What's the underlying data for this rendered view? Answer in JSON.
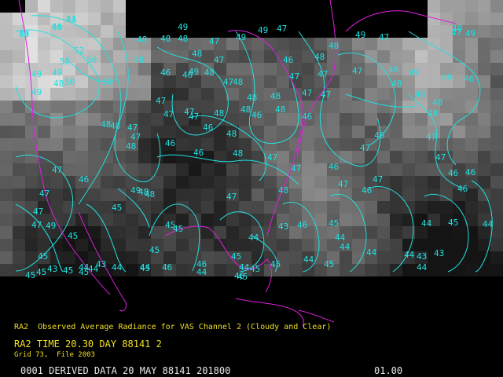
{
  "map": {
    "contour_color": "#22e0e0",
    "coast_color": "#e020e0",
    "caption_color": "#f0e020",
    "status_color": "#e8e8e8",
    "contour_labels": [
      "51",
      "50",
      "50",
      "52",
      "50",
      "50",
      "49",
      "50",
      "48",
      "49",
      "49",
      "50",
      "48",
      "48",
      "48",
      "49",
      "47",
      "49",
      "47",
      "48",
      "49",
      "47",
      "49",
      "47",
      "49",
      "49",
      "48",
      "46",
      "46",
      "48",
      "48",
      "47",
      "47",
      "48",
      "49",
      "46",
      "48",
      "47",
      "47",
      "48",
      "48",
      "47",
      "47",
      "48",
      "48",
      "48",
      "46",
      "47",
      "47",
      "46",
      "47",
      "47",
      "47",
      "48",
      "49",
      "49",
      "46",
      "48",
      "49",
      "48",
      "48",
      "48",
      "48",
      "47",
      "47",
      "48",
      "46",
      "48",
      "48",
      "46",
      "46",
      "47",
      "47",
      "46",
      "47",
      "46",
      "47",
      "47",
      "46",
      "46",
      "46",
      "46",
      "47",
      "47",
      "48",
      "49",
      "48",
      "47",
      "46",
      "47",
      "48",
      "47",
      "45",
      "47",
      "47",
      "49",
      "45",
      "45",
      "45",
      "45",
      "45",
      "46",
      "46",
      "46",
      "45",
      "45",
      "45",
      "44",
      "43",
      "46",
      "45",
      "44",
      "44",
      "44",
      "44",
      "44",
      "45",
      "44",
      "44",
      "44",
      "44",
      "45",
      "45",
      "45",
      "43",
      "44",
      "43",
      "44",
      "44",
      "44",
      "44",
      "45",
      "45",
      "45",
      "45",
      "43",
      "43",
      "44",
      "44",
      "44"
    ]
  },
  "caption": {
    "product_line": "RA2  Observed Average Radiance for VAS Channel 2 (Cloudy and Clear)",
    "time_line": "RA2 TIME 20.30 DAY 88141 2",
    "grid_line": "Grid 73,  File 2003"
  },
  "status_bar": {
    "left_text": "0001 DERIVED DATA 20 MAY 88141 201800",
    "right_text": "01.00"
  }
}
